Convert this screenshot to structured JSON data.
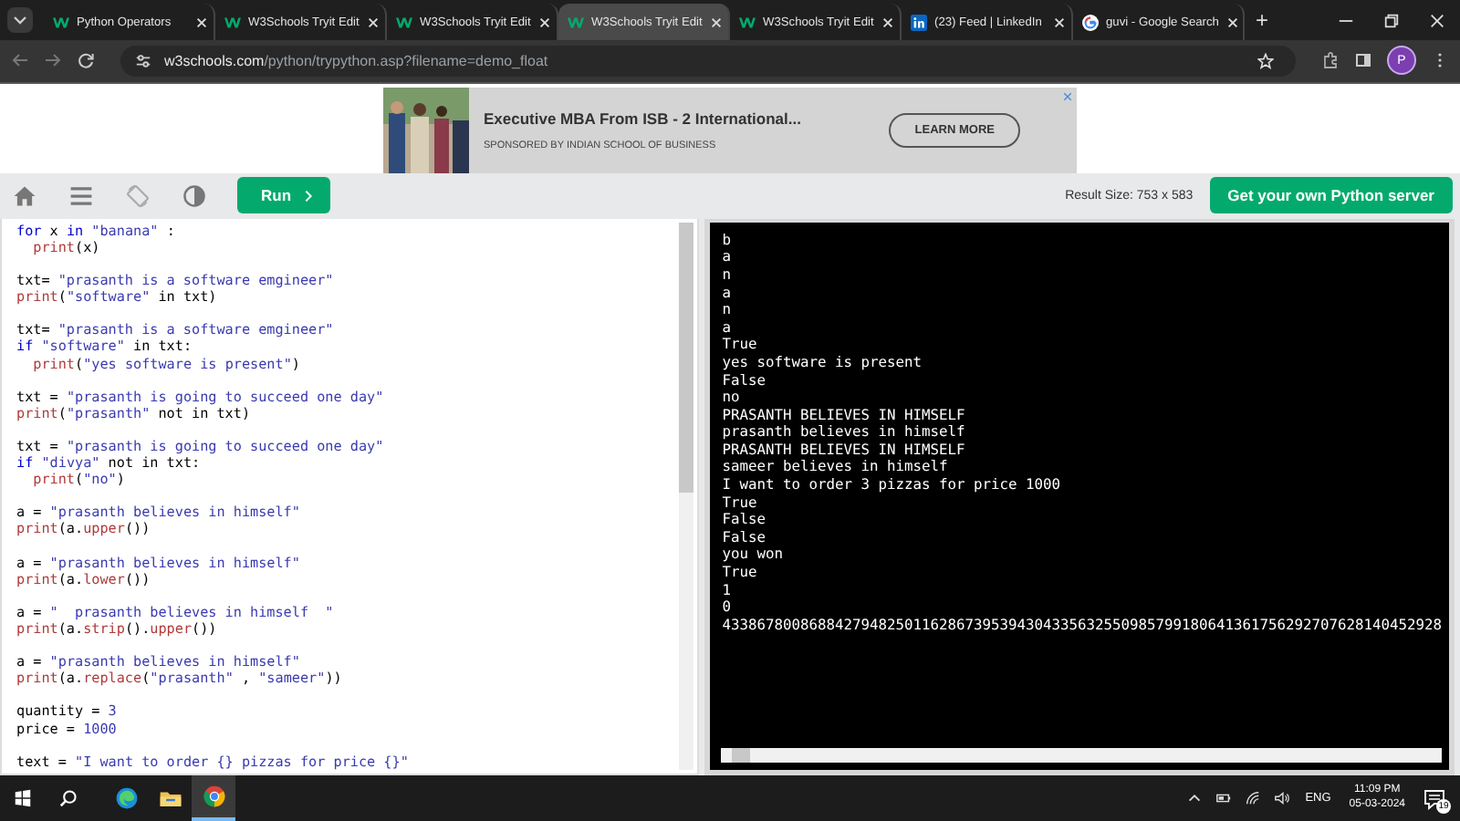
{
  "browser": {
    "tabs": [
      {
        "title": "Python Operators",
        "kind": "w3",
        "selected": false
      },
      {
        "title": "W3Schools Tryit Edit",
        "kind": "w3",
        "selected": false
      },
      {
        "title": "W3Schools Tryit Edit",
        "kind": "w3",
        "selected": false
      },
      {
        "title": "W3Schools Tryit Edit",
        "kind": "w3",
        "selected": true
      },
      {
        "title": "W3Schools Tryit Edit",
        "kind": "w3",
        "selected": false
      },
      {
        "title": "(23) Feed | LinkedIn",
        "kind": "linkedin",
        "selected": false
      },
      {
        "title": "guvi - Google Search",
        "kind": "google",
        "selected": false
      }
    ],
    "new_tab": "+",
    "address": {
      "host": "w3schools.com",
      "path": "/python/trypython.asp?filename=demo_float"
    },
    "profile": "P"
  },
  "ad": {
    "title": "Executive MBA From ISB - 2 International...",
    "sponsor": "SPONSORED BY INDIAN SCHOOL OF BUSINESS",
    "button": "LEARN MORE"
  },
  "toolbar": {
    "run": "Run",
    "result_size": "Result Size: 753 x 583",
    "server_button": "Get your own Python server"
  },
  "code_blocks": [
    [
      [
        {
          "kind": "kw",
          "t": "for"
        },
        {
          "kind": "p",
          "t": " x "
        },
        {
          "kind": "kw",
          "t": "in"
        },
        {
          "kind": "str",
          "t": " \"banana\""
        },
        {
          "kind": "p",
          "t": " :"
        }
      ],
      [
        {
          "kind": "fn",
          "t": "  print"
        },
        {
          "kind": "p",
          "t": "(x)"
        }
      ]
    ],
    [
      [
        {
          "kind": "p",
          "t": "txt= "
        },
        {
          "kind": "str",
          "t": "\"prasanth is a software emgineer\""
        }
      ],
      [
        {
          "kind": "fn",
          "t": "print"
        },
        {
          "kind": "p",
          "t": "("
        },
        {
          "kind": "str",
          "t": "\"software\""
        },
        {
          "kind": "p",
          "t": " in txt)"
        }
      ]
    ],
    [
      [
        {
          "kind": "p",
          "t": "txt= "
        },
        {
          "kind": "str",
          "t": "\"prasanth is a software emgineer\""
        }
      ],
      [
        {
          "kind": "kw",
          "t": "if"
        },
        {
          "kind": "str",
          "t": " \"software\""
        },
        {
          "kind": "p",
          "t": " in txt:"
        }
      ],
      [
        {
          "kind": "fn",
          "t": "  print"
        },
        {
          "kind": "p",
          "t": "("
        },
        {
          "kind": "str",
          "t": "\"yes software is present\""
        },
        {
          "kind": "p",
          "t": ")"
        }
      ]
    ],
    [
      [
        {
          "kind": "p",
          "t": "txt = "
        },
        {
          "kind": "str",
          "t": "\"prasanth is going to succeed one day\""
        }
      ],
      [
        {
          "kind": "fn",
          "t": "print"
        },
        {
          "kind": "p",
          "t": "("
        },
        {
          "kind": "str",
          "t": "\"prasanth\""
        },
        {
          "kind": "p",
          "t": " not in txt)"
        }
      ]
    ],
    [
      [
        {
          "kind": "p",
          "t": "txt = "
        },
        {
          "kind": "str",
          "t": "\"prasanth is going to succeed one day\""
        }
      ],
      [
        {
          "kind": "kw",
          "t": "if"
        },
        {
          "kind": "str",
          "t": " \"divya\""
        },
        {
          "kind": "p",
          "t": " not in txt:"
        }
      ],
      [
        {
          "kind": "fn",
          "t": "  print"
        },
        {
          "kind": "p",
          "t": "("
        },
        {
          "kind": "str",
          "t": "\"no\""
        },
        {
          "kind": "p",
          "t": ")"
        }
      ]
    ],
    [
      [
        {
          "kind": "p",
          "t": "a = "
        },
        {
          "kind": "str",
          "t": "\"prasanth believes in himself\""
        }
      ],
      [
        {
          "kind": "fn",
          "t": "print"
        },
        {
          "kind": "p",
          "t": "(a."
        },
        {
          "kind": "fn",
          "t": "upper"
        },
        {
          "kind": "p",
          "t": "())"
        }
      ]
    ],
    [
      [
        {
          "kind": "p",
          "t": "a = "
        },
        {
          "kind": "str",
          "t": "\"prasanth believes in himself\""
        }
      ],
      [
        {
          "kind": "fn",
          "t": "print"
        },
        {
          "kind": "p",
          "t": "(a."
        },
        {
          "kind": "fn",
          "t": "lower"
        },
        {
          "kind": "p",
          "t": "())"
        }
      ]
    ],
    [
      [
        {
          "kind": "p",
          "t": "a = "
        },
        {
          "kind": "str",
          "t": "\"  prasanth believes in himself  \""
        }
      ],
      [
        {
          "kind": "fn",
          "t": "print"
        },
        {
          "kind": "p",
          "t": "(a."
        },
        {
          "kind": "fn",
          "t": "strip"
        },
        {
          "kind": "p",
          "t": "()."
        },
        {
          "kind": "fn",
          "t": "upper"
        },
        {
          "kind": "p",
          "t": "())"
        }
      ]
    ],
    [
      [
        {
          "kind": "p",
          "t": "a = "
        },
        {
          "kind": "str",
          "t": "\"prasanth believes in himself\""
        }
      ],
      [
        {
          "kind": "fn",
          "t": "print"
        },
        {
          "kind": "p",
          "t": "(a."
        },
        {
          "kind": "fn",
          "t": "replace"
        },
        {
          "kind": "p",
          "t": "("
        },
        {
          "kind": "str",
          "t": "\"prasanth\""
        },
        {
          "kind": "p",
          "t": " , "
        },
        {
          "kind": "str",
          "t": "\"sameer\""
        },
        {
          "kind": "p",
          "t": "))"
        }
      ]
    ],
    [
      [
        {
          "kind": "p",
          "t": "quantity = "
        },
        {
          "kind": "num",
          "t": "3"
        }
      ],
      [
        {
          "kind": "p",
          "t": "price = "
        },
        {
          "kind": "num",
          "t": "1000"
        }
      ]
    ],
    [
      [
        {
          "kind": "p",
          "t": "text = "
        },
        {
          "kind": "str",
          "t": "\"I want to order {} pizzas for price {}\""
        }
      ]
    ]
  ],
  "output": [
    "b",
    "a",
    "n",
    "a",
    "n",
    "a",
    "True",
    "yes software is present",
    "False",
    "no",
    "PRASANTH BELIEVES IN HIMSELF",
    "prasanth believes in himself",
    "PRASANTH BELIEVES IN HIMSELF",
    "sameer believes in himself",
    "I want to order 3 pizzas for price 1000",
    "True",
    "False",
    "False",
    "you won",
    "True",
    "1",
    "0",
    "43386780086884279482501162867395394304335632550985799180641361756292707628140452928"
  ],
  "taskbar": {
    "apps": [
      {
        "kind": "edge",
        "selected": false
      },
      {
        "kind": "explorer",
        "selected": false
      },
      {
        "kind": "chrome",
        "selected": true
      }
    ],
    "language": "ENG",
    "time": "11:09 PM",
    "date": "05-03-2024",
    "notifications": "19"
  }
}
